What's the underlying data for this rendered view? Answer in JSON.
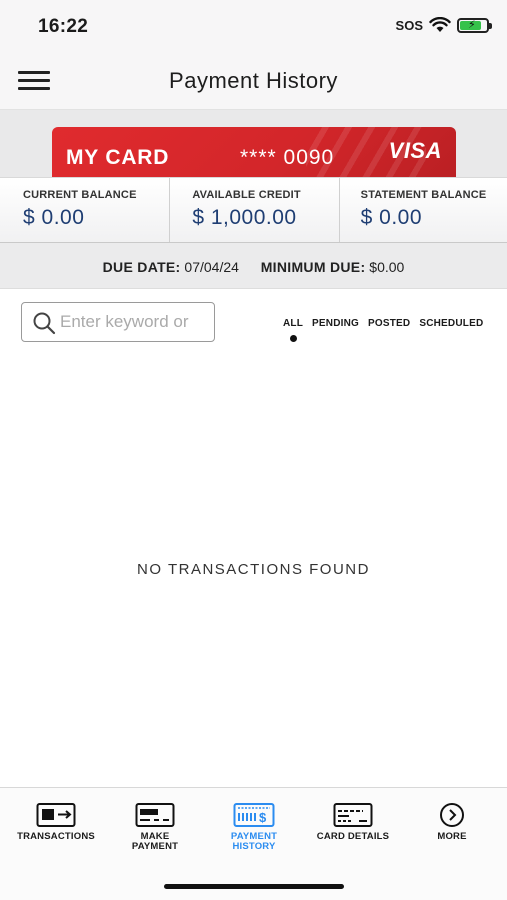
{
  "status_bar": {
    "time": "16:22",
    "sos": "SOS",
    "battery_level": 0.8,
    "battery_color": "#36c24a"
  },
  "header": {
    "title": "Payment History",
    "menu_icon": "hamburger-menu-icon"
  },
  "card": {
    "name": "MY CARD",
    "masked_number": "**** 0090",
    "network": "VISA",
    "color": "#d8282b"
  },
  "balances": [
    {
      "label": "CURRENT BALANCE",
      "value": "$ 0.00"
    },
    {
      "label": "AVAILABLE CREDIT",
      "value": "$ 1,000.00"
    },
    {
      "label": "STATEMENT BALANCE",
      "value": "$ 0.00"
    }
  ],
  "due": {
    "date_label": "DUE DATE:",
    "date_value": "07/04/24",
    "min_label": "MINIMUM DUE:",
    "min_value": "$0.00"
  },
  "search": {
    "placeholder": "Enter keyword or",
    "value": ""
  },
  "filters": {
    "items": [
      "ALL",
      "PENDING",
      "POSTED",
      "SCHEDULED"
    ],
    "selected": "ALL"
  },
  "empty_message": "NO TRANSACTIONS FOUND",
  "tabs": [
    {
      "label": "TRANSACTIONS",
      "icon": "transactions-icon",
      "active": false
    },
    {
      "label": "MAKE PAYMENT",
      "icon": "make-payment-icon",
      "active": false
    },
    {
      "label": "PAYMENT HISTORY",
      "icon": "payment-history-icon",
      "active": true
    },
    {
      "label": "CARD DETAILS",
      "icon": "card-details-icon",
      "active": false
    },
    {
      "label": "MORE",
      "icon": "more-icon",
      "active": false
    }
  ],
  "colors": {
    "accent_active": "#2b8cf0",
    "balance_text": "#1f3e73"
  }
}
